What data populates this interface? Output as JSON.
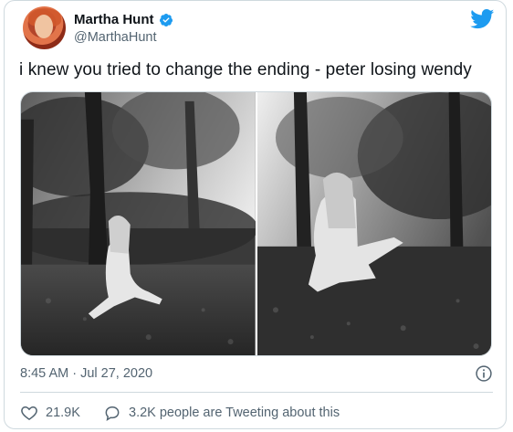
{
  "author": {
    "name": "Martha Hunt",
    "handle": "@MarthaHunt",
    "verified": true
  },
  "icons": {
    "verified": "verified-badge-icon",
    "twitter": "twitter-bird-icon",
    "info": "info-icon",
    "like": "heart-icon",
    "reply": "speech-bubble-icon"
  },
  "colors": {
    "twitter_blue": "#1d9bf0",
    "secondary_text": "#536471",
    "border": "#cfd9de"
  },
  "tweet": {
    "text": "i knew you tried to change the ending - peter losing wendy",
    "timestamp": "8:45 AM · Jul 27, 2020"
  },
  "media": {
    "photo_count": 2,
    "style": "black-and-white photos of a woman sitting on leaf-covered ground in a forest"
  },
  "stats": {
    "likes": "21.9K",
    "conversation": "3.2K people are Tweeting about this"
  }
}
